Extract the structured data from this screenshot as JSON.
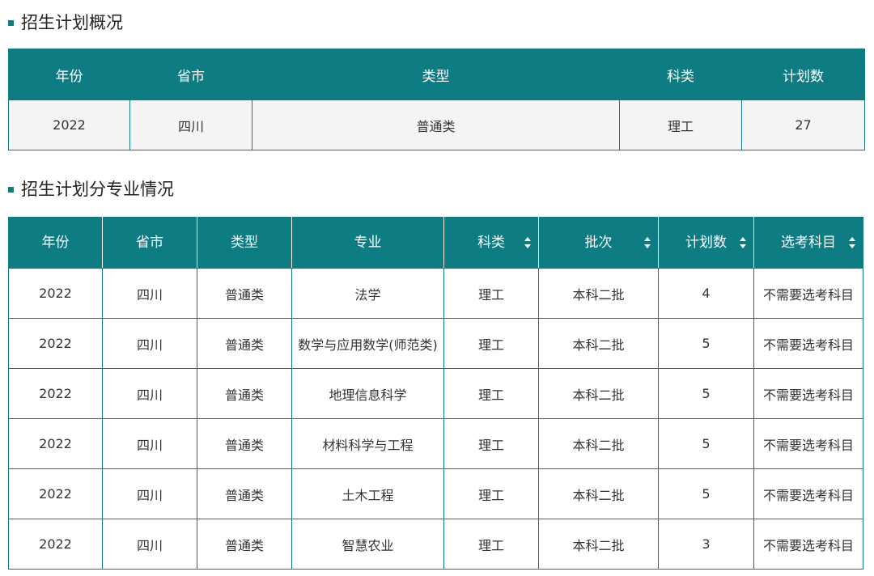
{
  "section1": {
    "title": "招生计划概况",
    "headers": [
      "年份",
      "省市",
      "类型",
      "科类",
      "计划数"
    ],
    "row": [
      "2022",
      "四川",
      "普通类",
      "理工",
      "27"
    ]
  },
  "section2": {
    "title": "招生计划分专业情况",
    "headers": [
      {
        "label": "年份",
        "sortable": false
      },
      {
        "label": "省市",
        "sortable": false
      },
      {
        "label": "类型",
        "sortable": false
      },
      {
        "label": "专业",
        "sortable": false
      },
      {
        "label": "科类",
        "sortable": true,
        "icon": "sort-icon"
      },
      {
        "label": "批次",
        "sortable": true,
        "icon": "sort-icon"
      },
      {
        "label": "计划数",
        "sortable": true,
        "icon": "sort-icon"
      },
      {
        "label": "选考科目",
        "sortable": true,
        "icon": "sort-icon"
      }
    ],
    "rows": [
      [
        "2022",
        "四川",
        "普通类",
        "法学",
        "理工",
        "本科二批",
        "4",
        "不需要选考科目"
      ],
      [
        "2022",
        "四川",
        "普通类",
        "数学与应用数学(师范类)",
        "理工",
        "本科二批",
        "5",
        "不需要选考科目"
      ],
      [
        "2022",
        "四川",
        "普通类",
        "地理信息科学",
        "理工",
        "本科二批",
        "5",
        "不需要选考科目"
      ],
      [
        "2022",
        "四川",
        "普通类",
        "材料科学与工程",
        "理工",
        "本科二批",
        "5",
        "不需要选考科目"
      ],
      [
        "2022",
        "四川",
        "普通类",
        "土木工程",
        "理工",
        "本科二批",
        "5",
        "不需要选考科目"
      ],
      [
        "2022",
        "四川",
        "普通类",
        "智慧农业",
        "理工",
        "本科二批",
        "3",
        "不需要选考科目"
      ]
    ]
  },
  "colors": {
    "accent": "#0e7d83",
    "header_text": "#ffffff",
    "row_bg": "#f4f4f4"
  }
}
